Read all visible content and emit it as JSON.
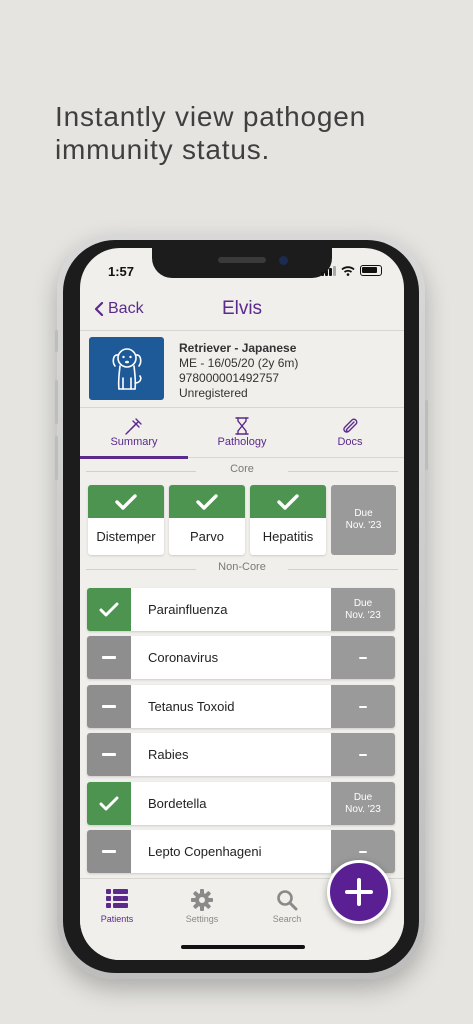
{
  "headline": {
    "line1": "Instantly view pathogen",
    "line2": "immunity status."
  },
  "status_bar": {
    "time": "1:57"
  },
  "nav": {
    "back_label": "Back",
    "title": "Elvis"
  },
  "pet": {
    "breed": "Retriever - Japanese",
    "details": "ME - 16/05/20 (2y 6m)",
    "microchip": "978000001492757",
    "registration": "Unregistered",
    "avatar_icon": "dog-icon"
  },
  "tabs": [
    {
      "label": "Summary",
      "icon": "syringe-icon",
      "active": true
    },
    {
      "label": "Pathology",
      "icon": "hourglass-icon",
      "active": false
    },
    {
      "label": "Docs",
      "icon": "paperclip-icon",
      "active": false
    }
  ],
  "sections": {
    "core": "Core",
    "non_core": "Non-Core"
  },
  "core_vaccines": [
    {
      "name": "Distemper",
      "status": "protected"
    },
    {
      "name": "Parvo",
      "status": "protected"
    },
    {
      "name": "Hepatitis",
      "status": "protected"
    }
  ],
  "core_due": {
    "line1": "Due",
    "line2": "Nov. '23"
  },
  "non_core_vaccines": [
    {
      "name": "Parainfluenza",
      "status": "protected",
      "due1": "Due",
      "due2": "Nov. '23"
    },
    {
      "name": "Coronavirus",
      "status": "none",
      "due1": "",
      "due2": ""
    },
    {
      "name": "Tetanus Toxoid",
      "status": "none",
      "due1": "",
      "due2": ""
    },
    {
      "name": "Rabies",
      "status": "none",
      "due1": "",
      "due2": ""
    },
    {
      "name": "Bordetella",
      "status": "protected",
      "due1": "Due",
      "due2": "Nov. '23"
    },
    {
      "name": "Lepto Copenhageni",
      "status": "none",
      "due1": "",
      "due2": ""
    }
  ],
  "bottom_nav": [
    {
      "label": "Patients",
      "icon": "list-icon",
      "active": true
    },
    {
      "label": "Settings",
      "icon": "gear-icon",
      "active": false
    },
    {
      "label": "Search",
      "icon": "search-icon",
      "active": false
    }
  ],
  "fab": {
    "icon": "plus-icon"
  },
  "colors": {
    "brand_purple": "#5b2a8d",
    "protected_green": "#4c9450",
    "none_gray": "#8e8e8e",
    "due_gray": "#9a9a9a",
    "avatar_blue": "#1f5a98"
  }
}
